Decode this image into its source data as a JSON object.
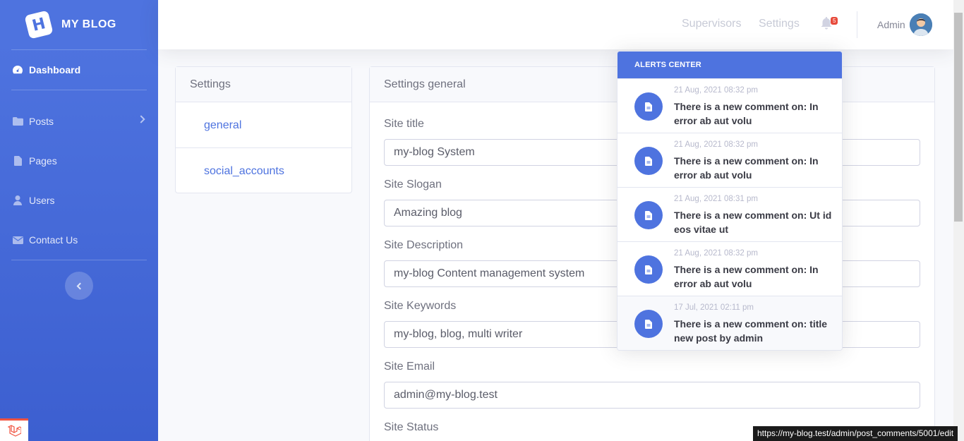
{
  "brand": {
    "logo_letter": "H",
    "name": "MY BLOG"
  },
  "sidebar": {
    "items": [
      {
        "label": "Dashboard",
        "icon": "tachometer-icon"
      },
      {
        "label": "Posts",
        "icon": "folder-icon"
      },
      {
        "label": "Pages",
        "icon": "file-icon"
      },
      {
        "label": "Users",
        "icon": "user-icon"
      },
      {
        "label": "Contact Us",
        "icon": "envelope-icon"
      }
    ]
  },
  "topbar": {
    "links": [
      "Supervisors",
      "Settings"
    ],
    "notification_count": "5",
    "user_name": "Admin"
  },
  "settings_card": {
    "title": "Settings",
    "items": [
      "general",
      "social_accounts"
    ]
  },
  "general_card": {
    "title": "Settings general",
    "fields": [
      {
        "label": "Site title",
        "value": "my-blog System"
      },
      {
        "label": "Site Slogan",
        "value": "Amazing blog"
      },
      {
        "label": "Site Description",
        "value": "my-blog Content management system"
      },
      {
        "label": "Site Keywords",
        "value": "my-blog, blog, multi writer"
      },
      {
        "label": "Site Email",
        "value": "admin@my-blog.test"
      },
      {
        "label": "Site Status",
        "value": ""
      }
    ]
  },
  "alerts": {
    "header": "ALERTS CENTER",
    "items": [
      {
        "date": "21 Aug, 2021 08:32 pm",
        "text": "There is a new comment on: In error ab aut volu"
      },
      {
        "date": "21 Aug, 2021 08:32 pm",
        "text": "There is a new comment on: In error ab aut volu"
      },
      {
        "date": "21 Aug, 2021 08:31 pm",
        "text": "There is a new comment on: Ut id eos vitae ut"
      },
      {
        "date": "21 Aug, 2021 08:32 pm",
        "text": "There is a new comment on: In error ab aut volu"
      },
      {
        "date": "17 Jul, 2021 02:11 pm",
        "text": "There is a new comment on: title new post by admin"
      }
    ]
  },
  "status_bar": {
    "url": "https://my-blog.test/admin/post_comments/5001/edit"
  },
  "colors": {
    "primary": "#4e73df",
    "badge": "#e74a3b",
    "laravel": "#f05340"
  }
}
